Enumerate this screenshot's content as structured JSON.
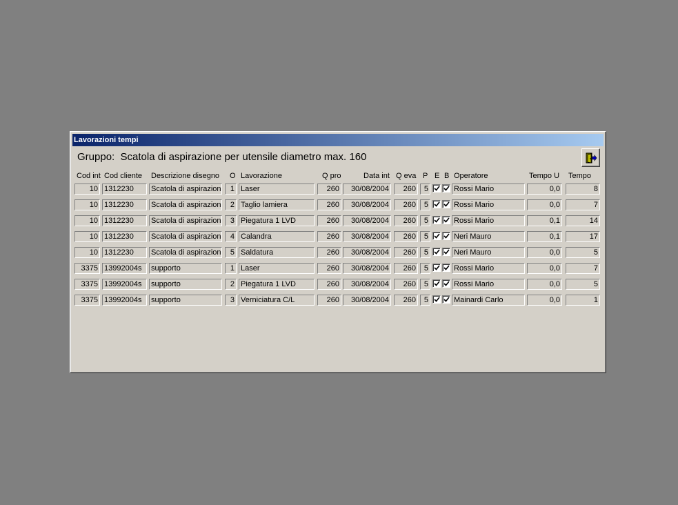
{
  "window": {
    "title": "Lavorazioni tempi"
  },
  "group": {
    "label": "Gruppo:",
    "name": "Scatola di aspirazione per utensile diametro max. 160"
  },
  "headers": {
    "cod_int": "Cod int",
    "cod_cliente": "Cod cliente",
    "descrizione": "Descrizione disegno",
    "o": "O",
    "lavorazione": "Lavorazione",
    "q_pro": "Q pro",
    "data_int": "Data int",
    "q_eva": "Q eva",
    "p": "P",
    "e": "E",
    "b": "B",
    "operatore": "Operatore",
    "tempo_u": "Tempo U",
    "tempo": "Tempo"
  },
  "rows": [
    {
      "cod_int": "10",
      "cod_cliente": "1312230",
      "descrizione": "Scatola di aspirazione",
      "o": "1",
      "lavorazione": "Laser",
      "q_pro": "260",
      "data_int": "30/08/2004",
      "q_eva": "260",
      "p": "5",
      "e": true,
      "b": true,
      "operatore": "Rossi Mario",
      "tempo_u": "0,0",
      "tempo": "8"
    },
    {
      "cod_int": "10",
      "cod_cliente": "1312230",
      "descrizione": "Scatola di aspirazione",
      "o": "2",
      "lavorazione": "Taglio lamiera",
      "q_pro": "260",
      "data_int": "30/08/2004",
      "q_eva": "260",
      "p": "5",
      "e": true,
      "b": true,
      "operatore": "Rossi Mario",
      "tempo_u": "0,0",
      "tempo": "7"
    },
    {
      "cod_int": "10",
      "cod_cliente": "1312230",
      "descrizione": "Scatola di aspirazione",
      "o": "3",
      "lavorazione": "Piegatura 1 LVD",
      "q_pro": "260",
      "data_int": "30/08/2004",
      "q_eva": "260",
      "p": "5",
      "e": true,
      "b": true,
      "operatore": "Rossi Mario",
      "tempo_u": "0,1",
      "tempo": "14"
    },
    {
      "cod_int": "10",
      "cod_cliente": "1312230",
      "descrizione": "Scatola di aspirazione",
      "o": "4",
      "lavorazione": "Calandra",
      "q_pro": "260",
      "data_int": "30/08/2004",
      "q_eva": "260",
      "p": "5",
      "e": true,
      "b": true,
      "operatore": "Neri Mauro",
      "tempo_u": "0,1",
      "tempo": "17"
    },
    {
      "cod_int": "10",
      "cod_cliente": "1312230",
      "descrizione": "Scatola di aspirazione",
      "o": "5",
      "lavorazione": "Saldatura",
      "q_pro": "260",
      "data_int": "30/08/2004",
      "q_eva": "260",
      "p": "5",
      "e": true,
      "b": true,
      "operatore": "Neri Mauro",
      "tempo_u": "0,0",
      "tempo": "5"
    },
    {
      "cod_int": "3375",
      "cod_cliente": "13992004s",
      "descrizione": "supporto",
      "o": "1",
      "lavorazione": "Laser",
      "q_pro": "260",
      "data_int": "30/08/2004",
      "q_eva": "260",
      "p": "5",
      "e": true,
      "b": true,
      "operatore": "Rossi Mario",
      "tempo_u": "0,0",
      "tempo": "7"
    },
    {
      "cod_int": "3375",
      "cod_cliente": "13992004s",
      "descrizione": "supporto",
      "o": "2",
      "lavorazione": "Piegatura 1 LVD",
      "q_pro": "260",
      "data_int": "30/08/2004",
      "q_eva": "260",
      "p": "5",
      "e": true,
      "b": true,
      "operatore": "Rossi Mario",
      "tempo_u": "0,0",
      "tempo": "5"
    },
    {
      "cod_int": "3375",
      "cod_cliente": "13992004s",
      "descrizione": "supporto",
      "o": "3",
      "lavorazione": "Verniciatura C/L",
      "q_pro": "260",
      "data_int": "30/08/2004",
      "q_eva": "260",
      "p": "5",
      "e": true,
      "b": true,
      "operatore": "Mainardi Carlo",
      "tempo_u": "0,0",
      "tempo": "1"
    }
  ],
  "icons": {
    "exit": "exit-door-icon",
    "checkbox": "checkmark-icon"
  },
  "colors": {
    "title_start": "#0a246a",
    "title_end": "#a6caf0",
    "face": "#d4d0c8",
    "desktop": "#808080"
  }
}
